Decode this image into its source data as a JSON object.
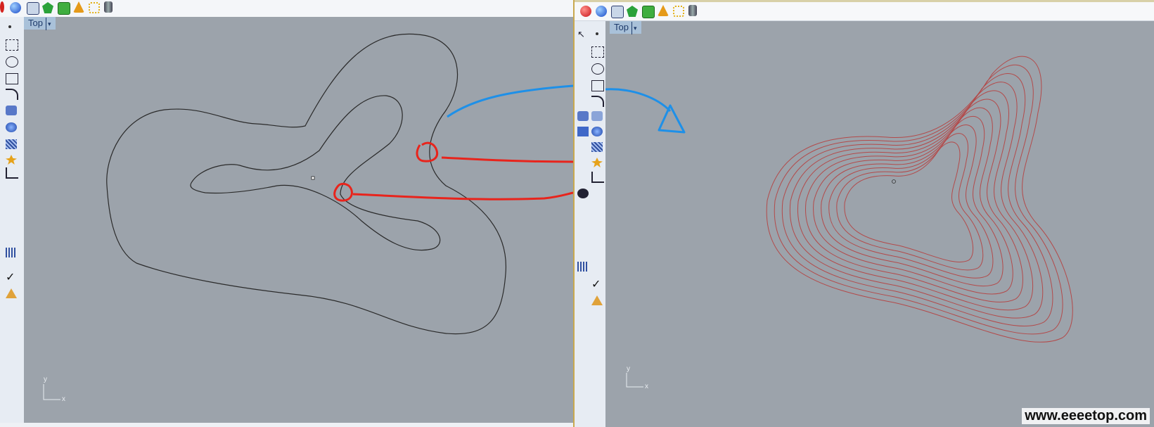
{
  "left_viewport": {
    "tab_label": "Top",
    "axis_y": "y",
    "axis_x": "x"
  },
  "right_viewport": {
    "tab_label": "Top",
    "axis_y": "y",
    "axis_x": "x"
  },
  "watermark": "www.eeeetop.com",
  "colors": {
    "viewport_bg": "#9ca3ab",
    "curve_left": "#2a2a2a",
    "curve_right": "#b34a4a",
    "annotation_red": "#e8241c",
    "annotation_blue": "#1e90e8",
    "tab_bg": "#a9c1d9"
  },
  "toolbar_icons": [
    "red-sphere-icon",
    "blue-sphere-icon",
    "cube-icon",
    "green-shape-icon",
    "green-box-icon",
    "cone-icon",
    "frame-icon",
    "cylinder-icon"
  ],
  "sidebar_icons": [
    "point-icon",
    "polyline-icon",
    "circle-icon",
    "rectangle-icon",
    "curve-icon",
    "surface-icon",
    "solid-icon",
    "mesh-icon",
    "explode-icon",
    "transform-icon",
    "array-icon",
    "check-icon",
    "render-icon"
  ]
}
